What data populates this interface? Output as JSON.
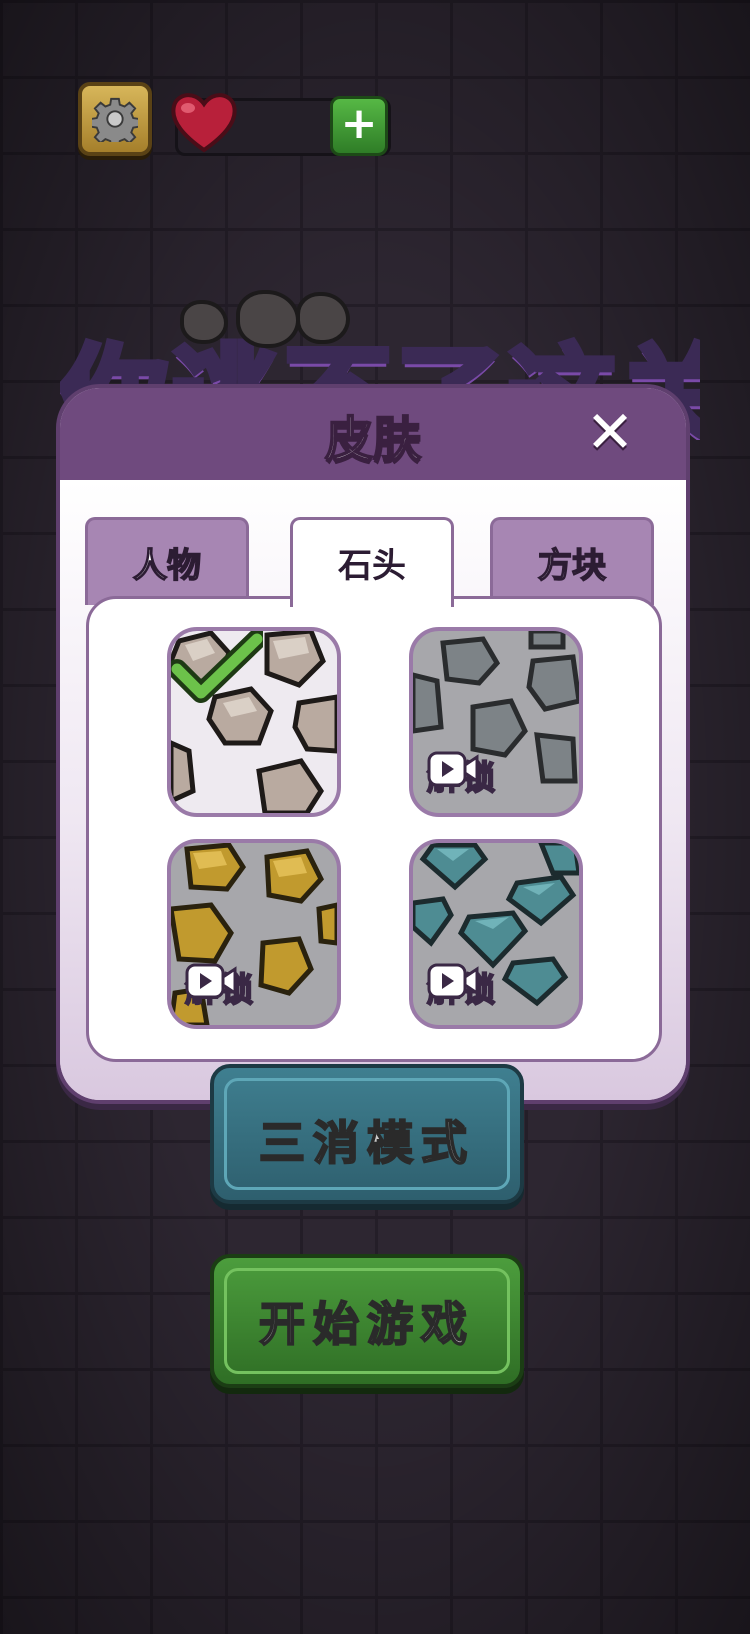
{
  "logo": {
    "text": "你逃不了这关"
  },
  "modal": {
    "title": "皮肤",
    "close_label": "✕",
    "tabs": [
      {
        "label": "人物",
        "active": false
      },
      {
        "label": "石头",
        "active": true
      },
      {
        "label": "方块",
        "active": false
      }
    ],
    "skins": [
      {
        "name": "brown-rocks",
        "state": "selected"
      },
      {
        "name": "gray-rocks",
        "state": "locked",
        "unlock_label": "解锁"
      },
      {
        "name": "gold-rocks",
        "state": "locked",
        "unlock_label": "解锁"
      },
      {
        "name": "diamond-rocks",
        "state": "locked",
        "unlock_label": "解锁"
      }
    ]
  },
  "buttons": {
    "mode_label": "三消模式",
    "start_label": "开始游戏"
  },
  "colors": {
    "accent_purple": "#6f4a7e",
    "start_green": "#3d8a30",
    "mode_teal": "#3a7585"
  }
}
